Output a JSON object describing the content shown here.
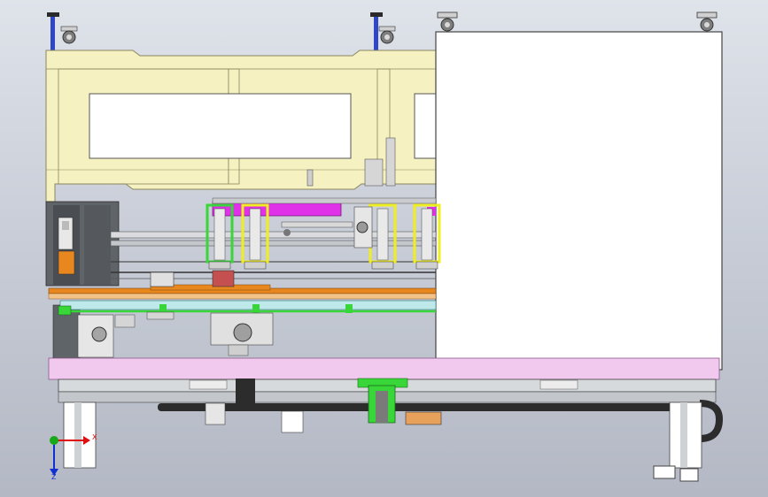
{
  "triad": {
    "x_label": "X",
    "z_label": "Z",
    "x_color": "#e01010",
    "z_color": "#1030d0",
    "origin_color": "#18a818"
  },
  "colors": {
    "frame": "#f6f1c1",
    "frame_edge": "#8a8660",
    "pink_base": "#f2c9ee",
    "magenta": "#e030e8",
    "green": "#39d639",
    "yellow": "#f0ee20",
    "orange": "#e8871e",
    "cyan_rail": "#bfe8ea",
    "panel": "#ffffff",
    "dark": "#303030",
    "grey": "#8e939a",
    "steel": "#b4b8be",
    "blue_post": "#2f46c8"
  }
}
